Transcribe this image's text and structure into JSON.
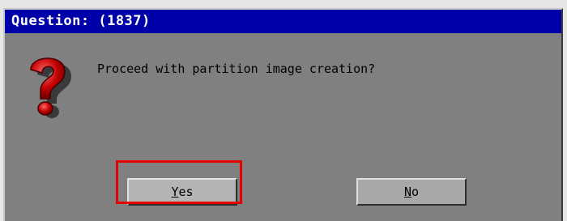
{
  "dialog": {
    "title": "Question: (1837)",
    "message": "Proceed with partition image creation?",
    "icon": "question-mark-icon"
  },
  "buttons": {
    "yes": {
      "mnemonic": "Y",
      "rest": "es"
    },
    "no": {
      "mnemonic": "N",
      "rest": "o"
    }
  },
  "colors": {
    "title_bar": "#0000a8",
    "dialog_body": "#808080",
    "button_face": "#a8a8a8",
    "highlight": "#e60000",
    "icon_red": "#c00000"
  }
}
